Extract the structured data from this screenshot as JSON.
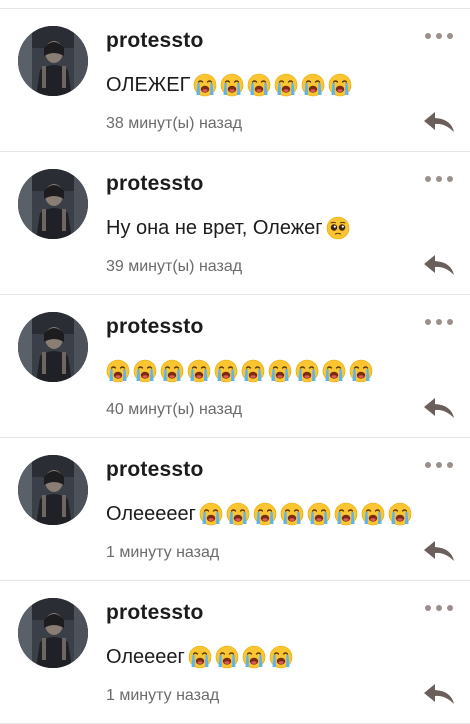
{
  "icons": {
    "more": "more-dots-icon",
    "reply": "reply-arrow-icon",
    "emoji_crying": "loudly-crying-face-emoji",
    "emoji_pleading": "pleading-face-emoji"
  },
  "colors": {
    "text": "#1c1c1c",
    "muted": "#6b6b6b",
    "icon": "#6a5f5b",
    "divider": "#e6e6e6"
  },
  "comments": [
    {
      "author": "protessto",
      "text": "ОЛЕЖЕГ",
      "emoji": [
        "crying",
        "crying",
        "crying",
        "crying",
        "crying",
        "crying"
      ],
      "time": "38 минут(ы) назад"
    },
    {
      "author": "protessto",
      "text": "Ну она не врет, Олежег",
      "emoji": [
        "pleading"
      ],
      "time": "39 минут(ы) назад"
    },
    {
      "author": "protessto",
      "text": "",
      "emoji": [
        "crying",
        "crying",
        "crying",
        "crying",
        "crying",
        "crying",
        "crying",
        "crying",
        "crying",
        "crying"
      ],
      "time": "40 минут(ы) назад"
    },
    {
      "author": "protessto",
      "text": "Олееееег",
      "emoji": [
        "crying",
        "crying",
        "crying",
        "crying",
        "crying",
        "crying",
        "crying",
        "crying"
      ],
      "time": "1 минуту назад"
    },
    {
      "author": "protessto",
      "text": "Олеееег",
      "emoji": [
        "crying",
        "crying",
        "crying",
        "crying"
      ],
      "time": "1 минуту назад"
    }
  ]
}
